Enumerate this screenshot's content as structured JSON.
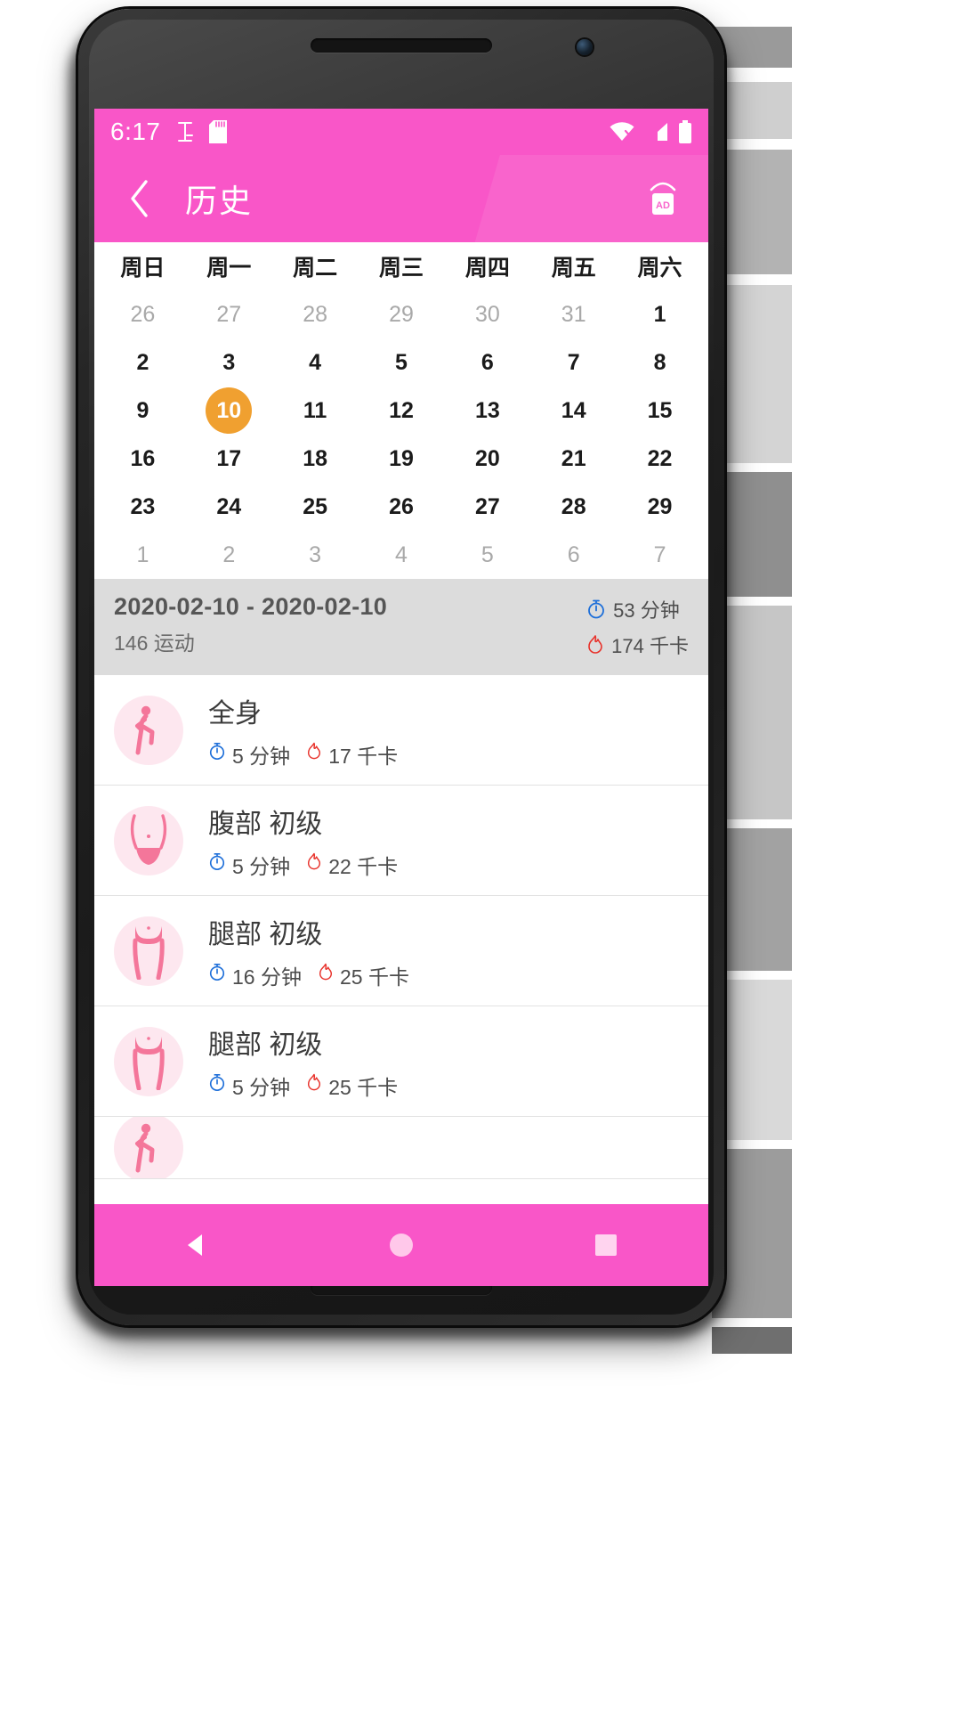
{
  "status_bar": {
    "time": "6:17",
    "icons": [
      "text-cursor-icon",
      "sd-card-icon",
      "wifi-icon",
      "signal-icon",
      "battery-icon"
    ]
  },
  "app_bar": {
    "back_icon": "chevron-left-icon",
    "title": "历史",
    "action_icon": "ad-badge-icon"
  },
  "calendar": {
    "weekdays": [
      "周日",
      "周一",
      "周二",
      "周三",
      "周四",
      "周五",
      "周六"
    ],
    "selected_day": "10",
    "selected_color": "#f0a030",
    "weeks": [
      [
        {
          "d": "26",
          "muted": true
        },
        {
          "d": "27",
          "muted": true
        },
        {
          "d": "28",
          "muted": true
        },
        {
          "d": "29",
          "muted": true
        },
        {
          "d": "30",
          "muted": true
        },
        {
          "d": "31",
          "muted": true
        },
        {
          "d": "1",
          "muted": false
        }
      ],
      [
        {
          "d": "2",
          "muted": false
        },
        {
          "d": "3",
          "muted": false
        },
        {
          "d": "4",
          "muted": false
        },
        {
          "d": "5",
          "muted": false
        },
        {
          "d": "6",
          "muted": false
        },
        {
          "d": "7",
          "muted": false
        },
        {
          "d": "8",
          "muted": false
        }
      ],
      [
        {
          "d": "9",
          "muted": false
        },
        {
          "d": "10",
          "muted": false,
          "selected": true
        },
        {
          "d": "11",
          "muted": false
        },
        {
          "d": "12",
          "muted": false
        },
        {
          "d": "13",
          "muted": false
        },
        {
          "d": "14",
          "muted": false
        },
        {
          "d": "15",
          "muted": false
        }
      ],
      [
        {
          "d": "16",
          "muted": false
        },
        {
          "d": "17",
          "muted": false
        },
        {
          "d": "18",
          "muted": false
        },
        {
          "d": "19",
          "muted": false
        },
        {
          "d": "20",
          "muted": false
        },
        {
          "d": "21",
          "muted": false
        },
        {
          "d": "22",
          "muted": false
        }
      ],
      [
        {
          "d": "23",
          "muted": false
        },
        {
          "d": "24",
          "muted": false
        },
        {
          "d": "25",
          "muted": false
        },
        {
          "d": "26",
          "muted": false
        },
        {
          "d": "27",
          "muted": false
        },
        {
          "d": "28",
          "muted": false
        },
        {
          "d": "29",
          "muted": false
        }
      ],
      [
        {
          "d": "1",
          "muted": true
        },
        {
          "d": "2",
          "muted": true
        },
        {
          "d": "3",
          "muted": true
        },
        {
          "d": "4",
          "muted": true
        },
        {
          "d": "5",
          "muted": true
        },
        {
          "d": "6",
          "muted": true
        },
        {
          "d": "7",
          "muted": true
        }
      ]
    ]
  },
  "summary": {
    "date_range": "2020-02-10 - 2020-02-10",
    "workout_count": "146 运动",
    "duration": "53 分钟",
    "calories": "174 千卡"
  },
  "workouts": [
    {
      "title": "全身",
      "duration": "5 分钟",
      "calories": "17 千卡",
      "thumb": "full-body-icon"
    },
    {
      "title": "腹部 初级",
      "duration": "5 分钟",
      "calories": "22 千卡",
      "thumb": "abs-icon"
    },
    {
      "title": "腿部 初级",
      "duration": "16 分钟",
      "calories": "25 千卡",
      "thumb": "legs-icon"
    },
    {
      "title": "腿部 初级",
      "duration": "5 分钟",
      "calories": "25 千卡",
      "thumb": "legs-icon"
    }
  ],
  "nav_bar": {
    "back_icon": "triangle-back-icon",
    "home_icon": "circle-home-icon",
    "recents_icon": "square-recents-icon"
  },
  "colors": {
    "accent_pink": "#f956c8",
    "selected_orange": "#f0a030",
    "summary_gray": "#dcdcdc",
    "timer_blue": "#1e6fd9",
    "flame_red": "#e8322b"
  }
}
